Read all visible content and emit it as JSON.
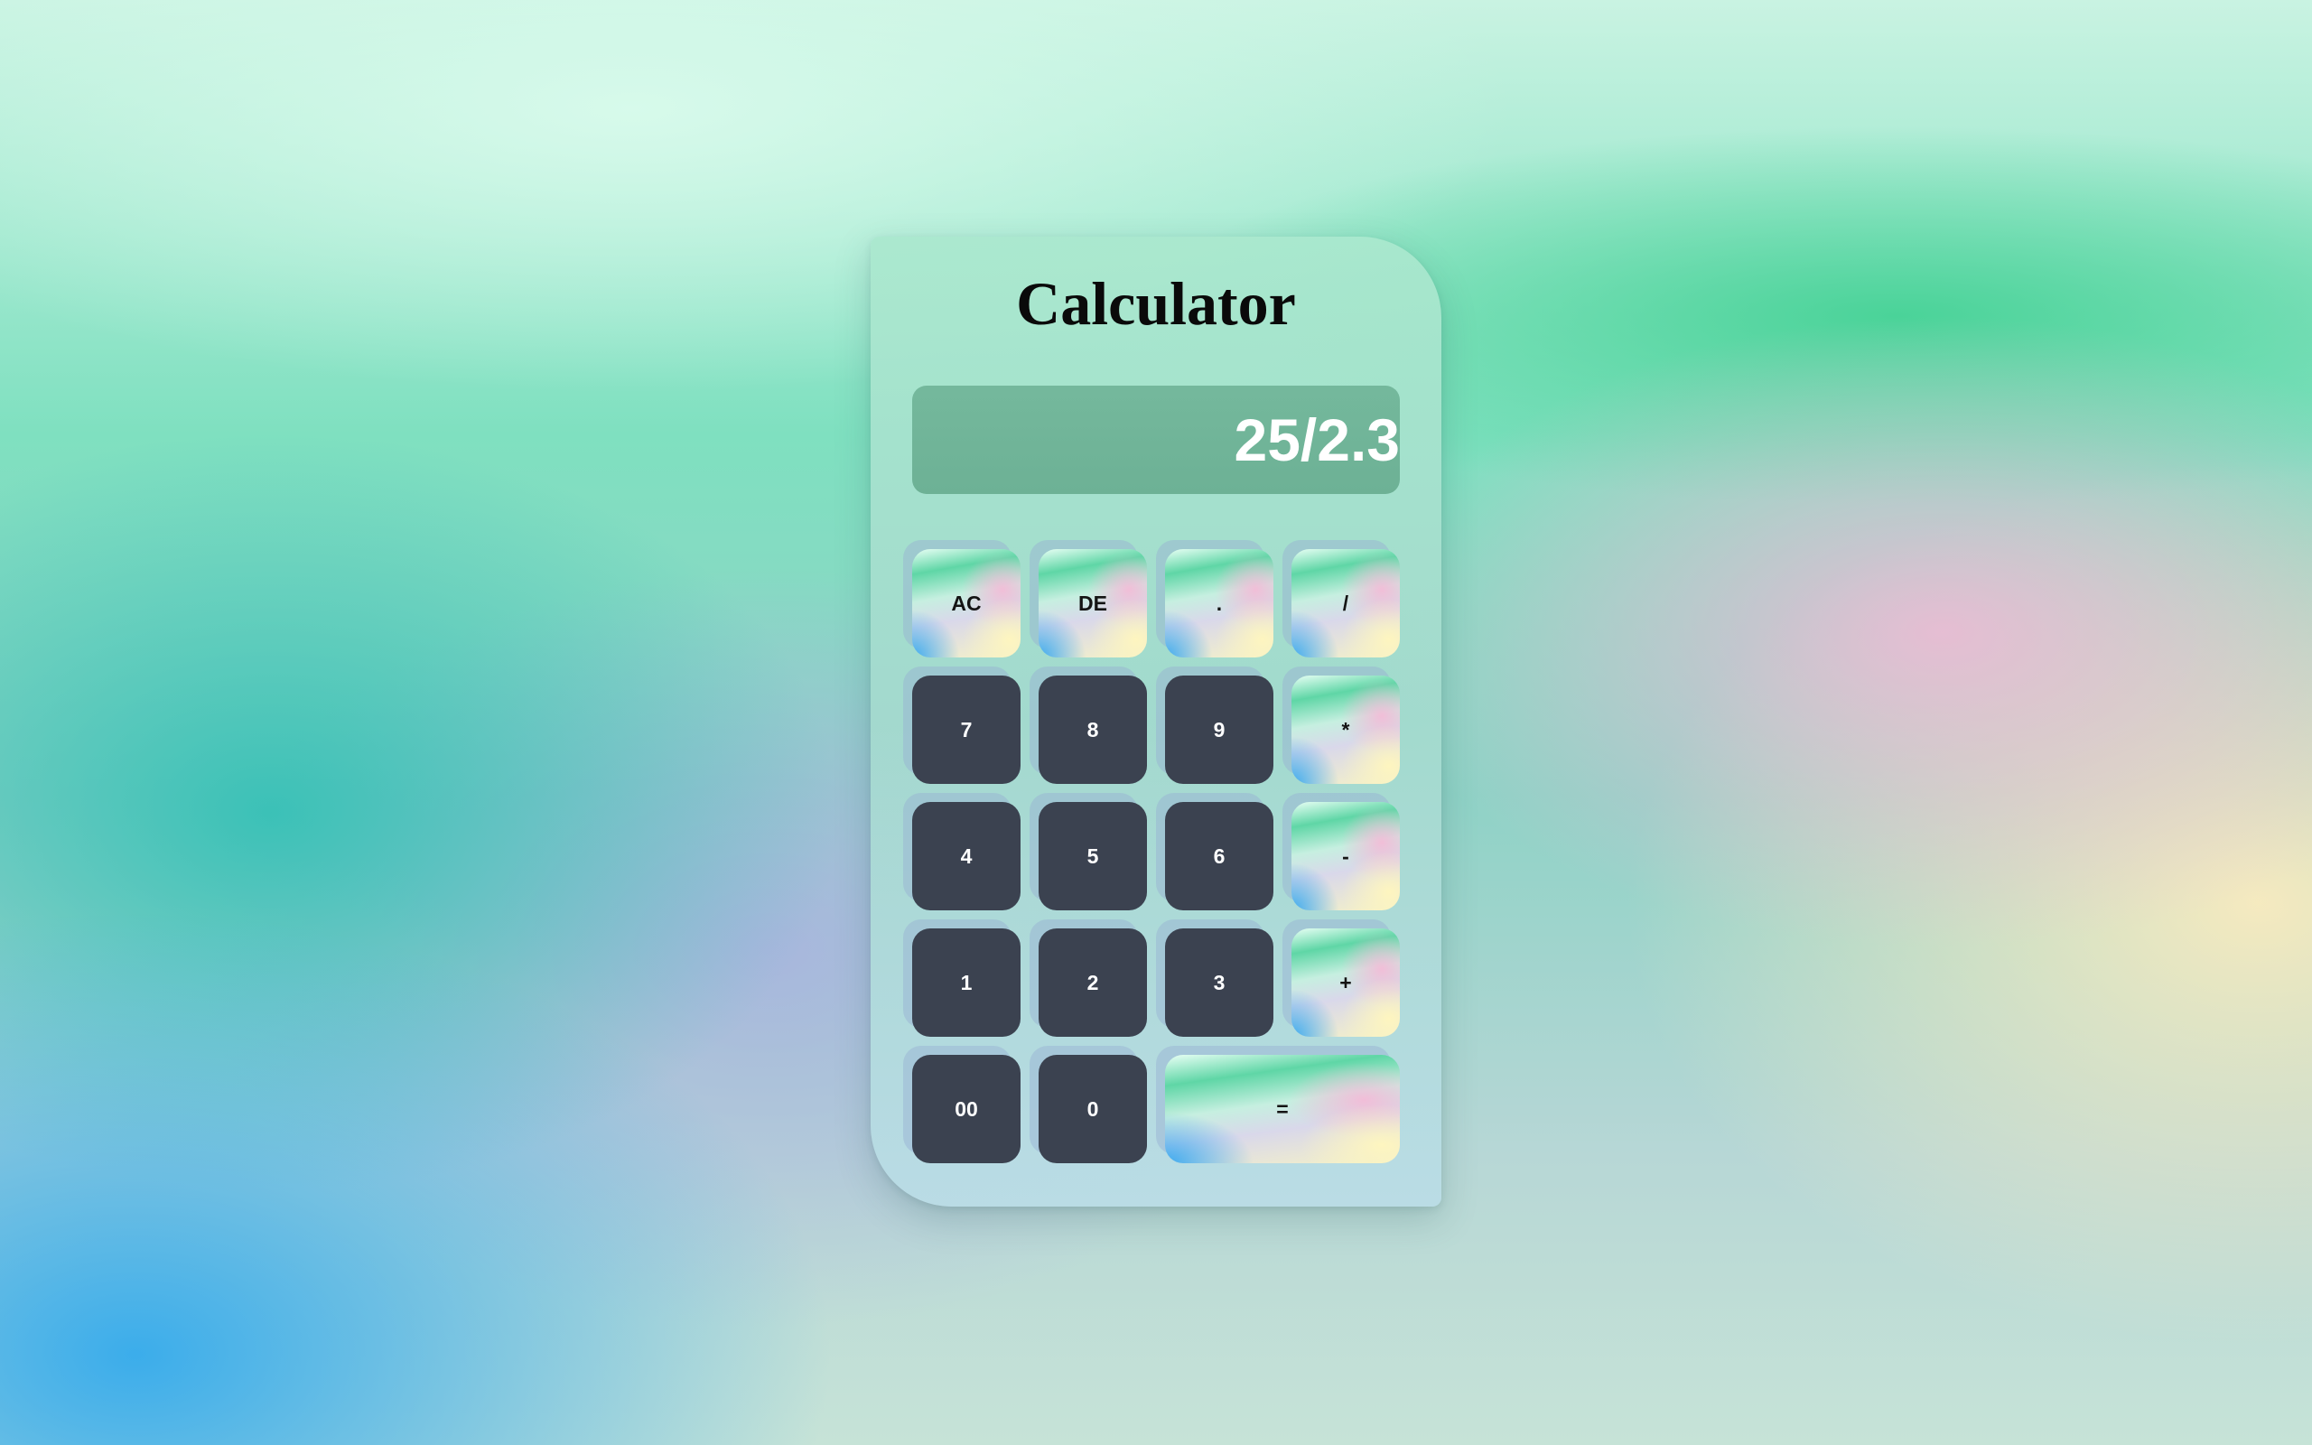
{
  "app": {
    "title": "Calculator"
  },
  "display": {
    "value": "25/2.3"
  },
  "keys": {
    "ac": "AC",
    "de": "DE",
    "dot": ".",
    "divide": "/",
    "seven": "7",
    "eight": "8",
    "nine": "9",
    "multiply": "*",
    "four": "4",
    "five": "5",
    "six": "6",
    "minus": "-",
    "one": "1",
    "two": "2",
    "three": "3",
    "plus": "+",
    "double_zero": "00",
    "zero": "0",
    "equals": "="
  },
  "colors": {
    "number_key": "#3b4250",
    "number_key_text": "#ffffff",
    "operator_key_text": "#141414",
    "display_text": "#ffffff"
  }
}
